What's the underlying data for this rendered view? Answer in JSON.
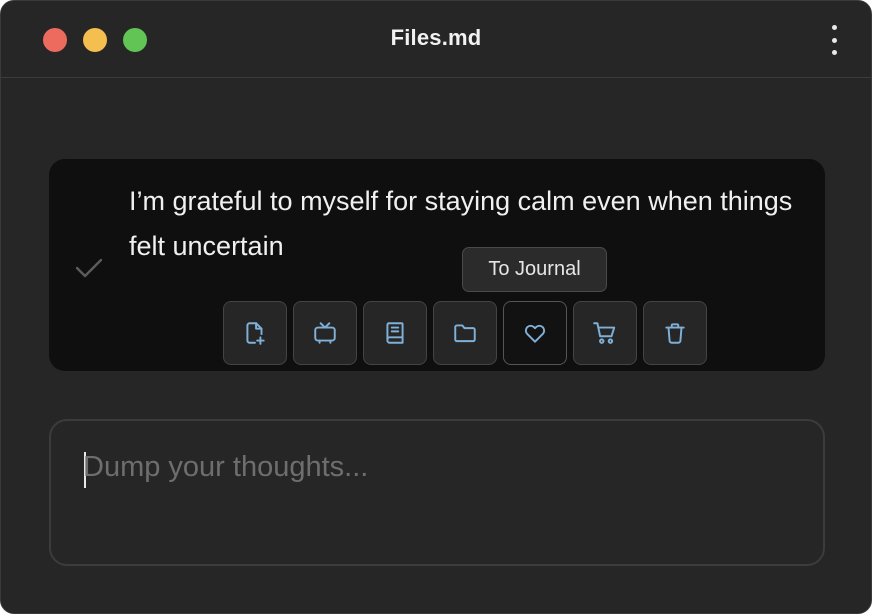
{
  "window": {
    "title": "Files.md"
  },
  "entry": {
    "text": "I’m grateful to myself for staying calm even when things felt uncertain",
    "completed": true
  },
  "tooltip": {
    "label": "To Journal"
  },
  "actions": [
    {
      "icon": "new-file-icon",
      "tooltip": "",
      "active": false
    },
    {
      "icon": "tv-icon",
      "tooltip": "",
      "active": false
    },
    {
      "icon": "book-icon",
      "tooltip": "",
      "active": false
    },
    {
      "icon": "folder-icon",
      "tooltip": "",
      "active": false
    },
    {
      "icon": "heart-icon",
      "tooltip": "To Journal",
      "active": true
    },
    {
      "icon": "cart-icon",
      "tooltip": "",
      "active": false
    },
    {
      "icon": "trash-icon",
      "tooltip": "",
      "active": false
    }
  ],
  "composer": {
    "value": "",
    "placeholder": "Dump your thoughts..."
  },
  "colors": {
    "window_bg": "#262626",
    "card_bg": "#0f0f0f",
    "icon_accent": "#7fb0d8",
    "traffic_red": "#ed6a5e",
    "traffic_yellow": "#f5bf4f",
    "traffic_green": "#61c454"
  }
}
